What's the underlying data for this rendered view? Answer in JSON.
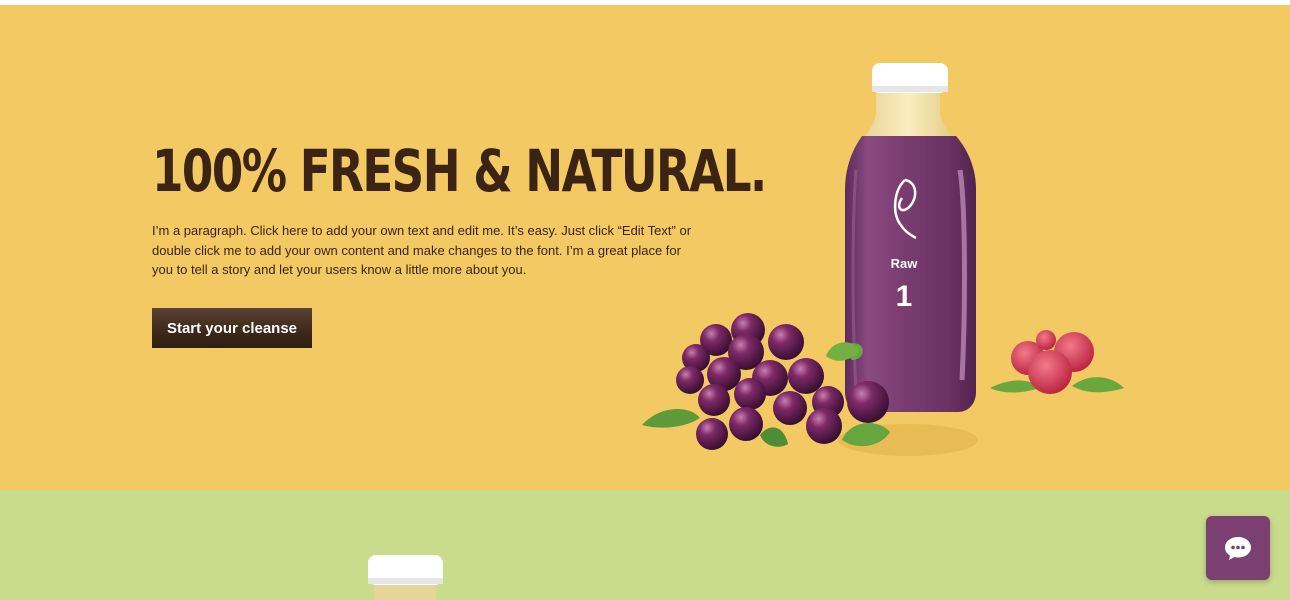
{
  "hero": {
    "heading": "100% FRESH & NATURAL.",
    "paragraph": "I’m a paragraph. Click here to add your own text and edit me. It’s easy. Just click “Edit Text” or double click me to add your own content and make changes to the font. I’m a great place for you to tell a story and let your users know a little more about you.",
    "cta_label": "Start your cleanse",
    "bottle": {
      "label": "Raw",
      "number": "1"
    }
  },
  "colors": {
    "hero_background": "#f2c962",
    "secondary_background": "#c9dc8c",
    "heading_text": "#3c2415",
    "button": "#3f2a1c",
    "juice": "#7b3f71",
    "chat_button": "#7b3f71"
  },
  "icons": {
    "chat": "chat-bubble-icon",
    "brand": "leaf-logo-icon"
  }
}
